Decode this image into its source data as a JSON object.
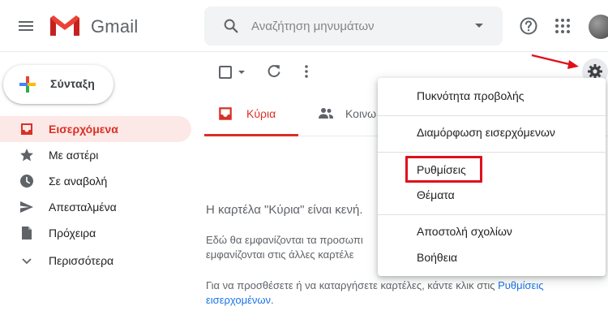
{
  "app": {
    "name": "Gmail",
    "brand_colors": {
      "red": "#d93025",
      "accent_blue": "#1a73e8",
      "arrow_red": "#e0101b"
    }
  },
  "search": {
    "placeholder": "Αναζήτηση μηνυμάτων",
    "icon": "search-icon"
  },
  "header_icons": [
    "hamburger-menu-icon",
    "gmail-logo",
    "search-options-caret-icon",
    "help-icon",
    "apps-grid-icon",
    "avatar"
  ],
  "sidebar": {
    "compose_label": "Σύνταξη",
    "items": [
      {
        "label": "Εισερχόμενα",
        "icon": "inbox-icon",
        "active": true
      },
      {
        "label": "Με αστέρι",
        "icon": "star-icon"
      },
      {
        "label": "Σε αναβολή",
        "icon": "clock-icon"
      },
      {
        "label": "Απεσταλμένα",
        "icon": "send-icon"
      },
      {
        "label": "Πρόχειρα",
        "icon": "draft-icon"
      },
      {
        "label": "Περισσότερα",
        "icon": "chevron-down-icon"
      }
    ]
  },
  "toolbar": {
    "icons": [
      "select-checkbox",
      "select-caret-icon",
      "refresh-icon",
      "more-vert-icon",
      "gear-icon"
    ]
  },
  "tabs": [
    {
      "label": "Κύρια",
      "icon": "inbox-icon",
      "active": true
    },
    {
      "label": "Κοινω",
      "icon": "people-icon"
    }
  ],
  "main": {
    "empty_title": "Η καρτέλα \"Κύρια\" είναι κενή.",
    "line1": "Εδώ θα εμφανίζονται τα προσωπι",
    "line2": "εμφανίζονται στις άλλες καρτέλε",
    "line3_prefix": "Για να προσθέσετε ή να καταργήσετε καρτέλες, κάντε κλικ στις ",
    "line3_link": "Ρυθμίσεις",
    "line4_link": "εισερχομένων",
    "line4_suffix": "."
  },
  "settings_menu": {
    "items": [
      {
        "label": "Πυκνότητα προβολής"
      },
      {
        "label": "Διαμόρφωση εισερχόμενων"
      },
      {
        "label": "Ρυθμίσεις",
        "highlighted": true
      },
      {
        "label": "Θέματα"
      },
      {
        "label": "Αποστολή σχολίων"
      },
      {
        "label": "Βοήθεια"
      }
    ]
  }
}
